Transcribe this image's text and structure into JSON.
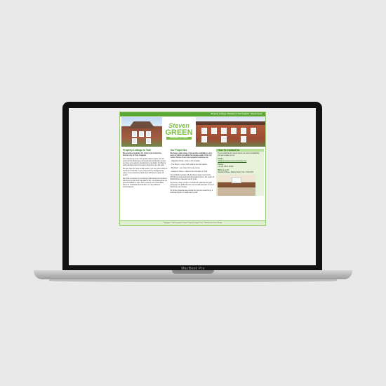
{
  "device": {
    "label": "MacBook Pro"
  },
  "site": {
    "topbar": "Property Lettings & Rentals in York England · Steven Green",
    "logo": {
      "line1": "Steven",
      "line2": "GREEN",
      "tagline": "PROPERTY LETTINGS"
    },
    "col1": {
      "title": "Property Lettings in York",
      "lead": "We provide properties for rent in and around the historic city of York, England.",
      "p1": "Our experience in the York rental market spans over 20 years and by delivering a professional and flexible service, we have succeeded in developing a reputation for offering well maintained and convenient properties at a fair price.",
      "p2": "We can cater for most rental needs, from very short stays of less than 6 months, to very long tenancy arrangements - some of our customers have been with us for nearly 15 years!",
      "p3": "We pride ourselves on providing unfurnished and furnished homes for people from all walks of life - recognising that our accommodation is often both a leisure and comfortable home for individuals and families in many different circumstances."
    },
    "col2": {
      "title": "Our Properties",
      "lead": "We have a wide range of properties available to rent, most of which are within 10 minutes walk of the city centre. Some of our most popular locations are:",
      "items": [
        "- Wigginton Road - close to the hospital",
        "- The Mount - only a short walk to the train station",
        "- Bootham - very close to the city centre",
        "- Lawrence Street - close to the University of York"
      ],
      "p1": "Our portfolio includes fully furnished single rooms from £75.00 per week and Executive apartments in the region of £1000.00 per calendar month (pcm).",
      "p2": "We have a large number of 2 bedroom apartments (with garages) from £650.00 pcm and a small selection of new 3 bedroom town houses.",
      "p3": "All of the properties we provide for rent are cared for by a dedicated team of maintenance staff."
    },
    "col3": {
      "title": "How To Contact Us",
      "intro": "If you would like to enquire about our current availability, you can contact us on:",
      "email_label": "Email:",
      "email": "info@stevengreenpropertylettings.com",
      "phone_label": "Phone:",
      "phone": "+44 (0) 79071 52390",
      "write_label": "Write to us at:",
      "address": "Sandford House, Malton Road, York, YO32 9TN"
    },
    "footer": "Copyright © 2007 by Steven Green Property Lettings York · Powered by Scrivio Studio"
  }
}
